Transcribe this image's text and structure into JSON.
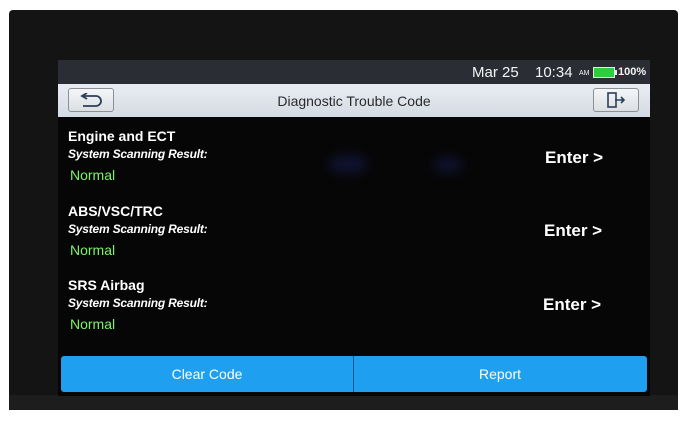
{
  "status_bar": {
    "date": "Mar 25",
    "time": "10:34",
    "ampm": "AM",
    "battery": "100%",
    "battery_icon": "battery-full-icon",
    "battery_color": "#2ecc40"
  },
  "header": {
    "title": "Diagnostic Trouble Code",
    "back_icon": "back-arrow-icon",
    "exit_icon": "exit-door-icon"
  },
  "systems": [
    {
      "name": "Engine and ECT",
      "subtitle": "System Scanning Result:",
      "status": "Normal",
      "enter": "Enter >"
    },
    {
      "name": "ABS/VSC/TRC",
      "subtitle": "System Scanning Result:",
      "status": "Normal",
      "enter": "Enter >"
    },
    {
      "name": "SRS Airbag",
      "subtitle": "System Scanning Result:",
      "status": "Normal",
      "enter": "Enter >"
    }
  ],
  "footer": {
    "clear_code": "Clear Code",
    "report": "Report",
    "accent_color": "#1f9ff0"
  },
  "colors": {
    "status_normal": "#7ff26a",
    "screen_bg": "#060606"
  }
}
